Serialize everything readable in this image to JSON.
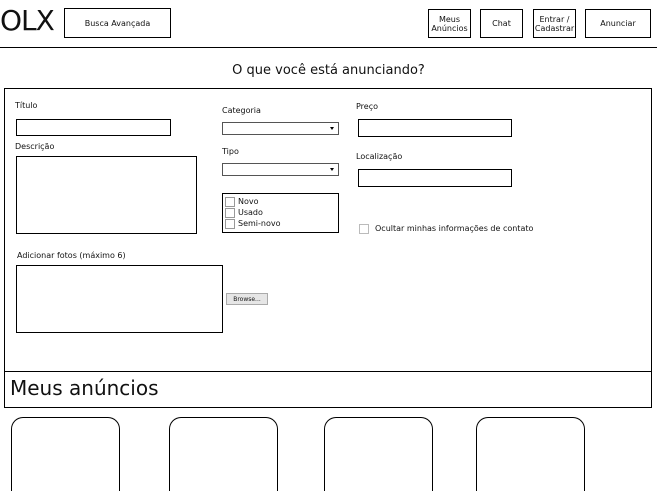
{
  "header": {
    "logo": "OLX",
    "advanced_search": "Busca Avançada",
    "my_ads": "Meus Anúncios",
    "chat": "Chat",
    "login": "Entrar / Cadastrar",
    "advertise": "Anunciar"
  },
  "form": {
    "heading": "O que você está anunciando?",
    "title_label": "Título",
    "description_label": "Descrição",
    "category_label": "Categoria",
    "type_label": "Tipo",
    "conditions": [
      "Novo",
      "Usado",
      "Semi-novo"
    ],
    "price_label": "Preço",
    "location_label": "Localização",
    "hide_contact_label": "Ocultar minhas informações de contato",
    "photos_label": "Adicionar fotos (máximo 6)",
    "browse": "Browse..."
  },
  "my_ads": {
    "heading": "Meus anúncios"
  }
}
